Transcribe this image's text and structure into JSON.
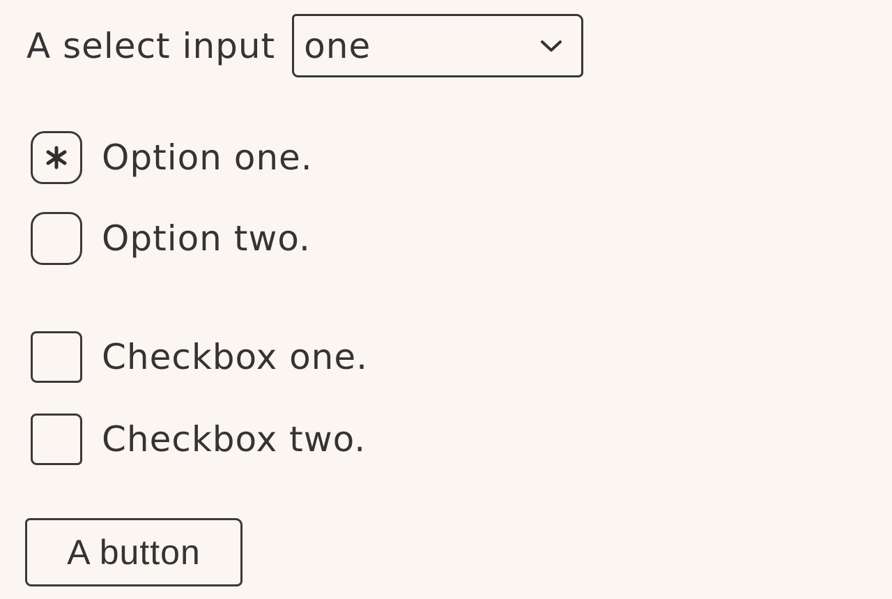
{
  "select": {
    "label": "A select input",
    "value": "one",
    "icon": "chevron-down-icon"
  },
  "radios": [
    {
      "label": "Option one.",
      "checked": true,
      "icon": "asterisk-icon"
    },
    {
      "label": "Option two.",
      "checked": false
    }
  ],
  "checkboxes": [
    {
      "label": "Checkbox one.",
      "checked": false
    },
    {
      "label": "Checkbox two.",
      "checked": false
    }
  ],
  "button": {
    "label": "A button"
  },
  "colors": {
    "background": "#fbf6f1",
    "ink": "#343434",
    "border": "#3a3a3a"
  }
}
